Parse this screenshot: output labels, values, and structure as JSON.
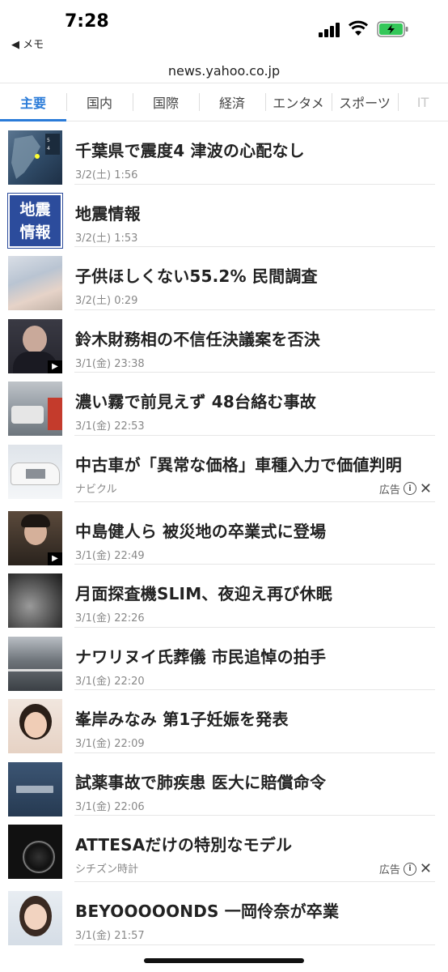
{
  "status": {
    "time": "7:28",
    "back_label": "◀ メモ"
  },
  "url": "news.yahoo.co.jp",
  "tabs": [
    {
      "label": "主要",
      "active": true
    },
    {
      "label": "国内"
    },
    {
      "label": "国際"
    },
    {
      "label": "経済"
    },
    {
      "label": "エンタメ"
    },
    {
      "label": "スポーツ"
    },
    {
      "label": "IT"
    }
  ],
  "items": [
    {
      "title": "千葉県で震度4 津波の心配なし",
      "meta": "3/2(土) 1:56",
      "thumb": "map-icon"
    },
    {
      "title": "地震情報",
      "meta": "3/2(土) 1:53",
      "thumb_text": "地震\n情報"
    },
    {
      "title": "子供ほしくない55.2% 民間調査",
      "meta": "3/2(土) 0:29"
    },
    {
      "title": "鈴木財務相の不信任決議案を否決",
      "meta": "3/1(金) 23:38"
    },
    {
      "title": "濃い霧で前見えず 48台絡む事故",
      "meta": "3/1(金) 22:53"
    },
    {
      "title": "中古車が「異常な価格」車種入力で価値判明",
      "meta": "ナビクル",
      "ad_label": "広告"
    },
    {
      "title": "中島健人ら 被災地の卒業式に登場",
      "meta": "3/1(金) 22:49"
    },
    {
      "title": "月面探査機SLIM、夜迎え再び休眠",
      "meta": "3/1(金) 22:26"
    },
    {
      "title": "ナワリヌイ氏葬儀 市民追悼の拍手",
      "meta": "3/1(金) 22:20"
    },
    {
      "title": "峯岸みなみ 第1子妊娠を発表",
      "meta": "3/1(金) 22:09"
    },
    {
      "title": "試薬事故で肺疾患 医大に賠償命令",
      "meta": "3/1(金) 22:06"
    },
    {
      "title": "ATTESAだけの特別なモデル",
      "meta": "シチズン時計",
      "ad_label": "広告"
    },
    {
      "title": "BEYOOOOONDS 一岡伶奈が卒業",
      "meta": "3/1(金) 21:57"
    }
  ],
  "colors": {
    "accent": "#2a7bd8",
    "battery": "#34c759"
  }
}
